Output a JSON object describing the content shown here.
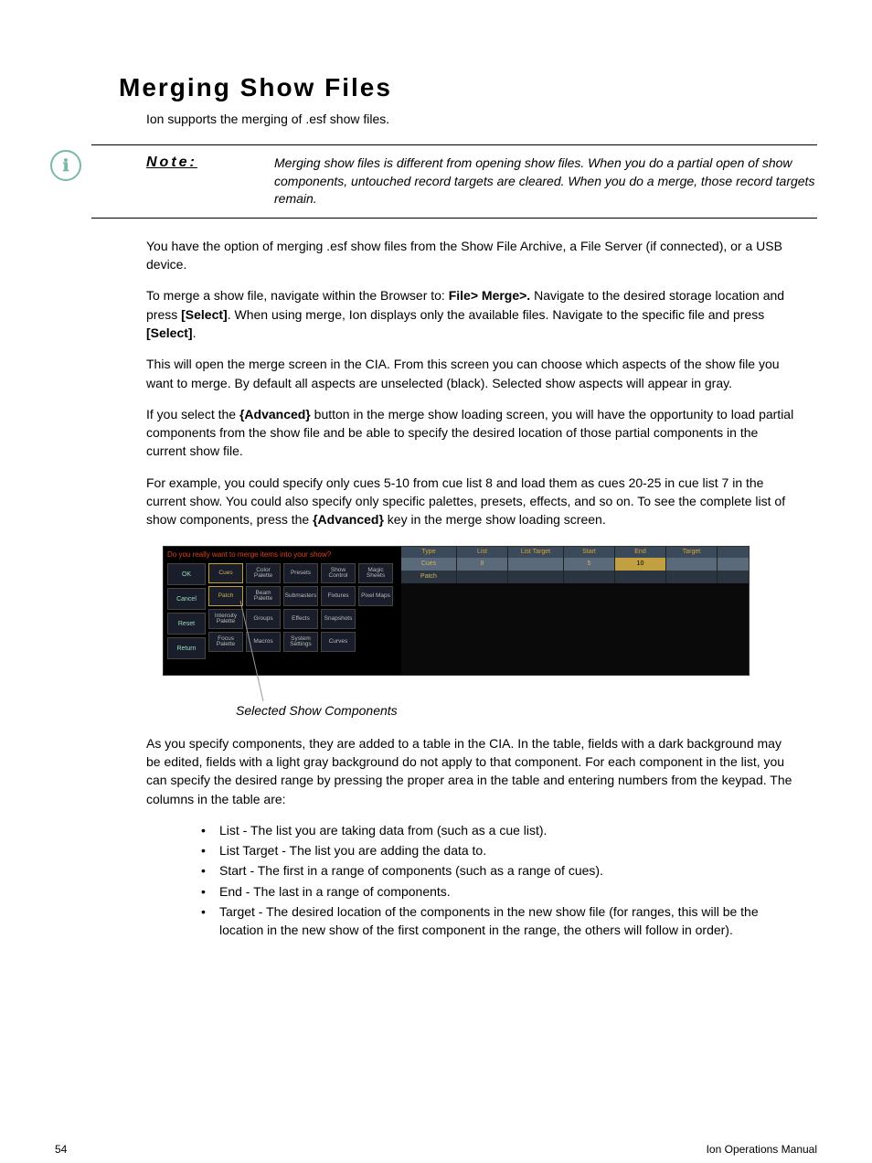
{
  "title": "Merging Show Files",
  "intro": "Ion supports the merging of .esf show files.",
  "note": {
    "label": "Note:",
    "text": "Merging show files is different from opening show files. When you do a partial open of show components, untouched record targets are cleared. When you do a merge, those record targets remain."
  },
  "para1": "You have the option of merging .esf show files from the Show File Archive, a File Server (if connected), or a USB device.",
  "para2_a": "To merge a show file, navigate within the Browser to: ",
  "para2_b": "File> Merge>.",
  "para2_c": " Navigate to the desired storage location and press ",
  "para2_d": "[Select]",
  "para2_e": ". When using merge, Ion displays only the available files. Navigate to the specific file and press ",
  "para2_f": "[Select]",
  "para2_g": ".",
  "para3": "This will open the merge screen in the CIA. From this screen you can choose which aspects of the show file you want to merge. By default all aspects are unselected (black). Selected show aspects will appear in gray.",
  "para4_a": "If you select the ",
  "para4_b": "{Advanced}",
  "para4_c": " button in the merge show loading screen, you will have the opportunity to load partial components from the show file and be able to specify the desired location of those partial components in the current show file.",
  "para5_a": "For example, you could specify only cues 5-10 from cue list 8 and load them as cues 20-25 in cue list 7 in the current show. You could also specify only specific palettes, presets, effects, and so on. To see the complete list of show components, press the ",
  "para5_b": "{Advanced}",
  "para5_c": " key in the merge show loading screen.",
  "screenshot": {
    "prompt": "Do you really want to merge items into your show?",
    "side_buttons": [
      "OK",
      "Cancel",
      "Reset",
      "Return"
    ],
    "grid": [
      [
        "Cues",
        "Color Palette",
        "Presets",
        "Show Control",
        "Magic Sheets"
      ],
      [
        "Patch",
        "Beam Palette",
        "Submasters",
        "Fixtures",
        "Pixel Maps"
      ],
      [
        "Intensity Palette",
        "Groups",
        "Effects",
        "Snapshots",
        ""
      ],
      [
        "Focus Palette",
        "Macros",
        "System Settings",
        "Curves",
        ""
      ]
    ],
    "selected": [
      "Cues",
      "Patch"
    ],
    "table": {
      "headers": [
        "Type",
        "List",
        "List Target",
        "Start",
        "End",
        "Target"
      ],
      "rows": [
        {
          "type": "Cues",
          "list": "8",
          "list_target": "",
          "start": "5",
          "end": "10",
          "target": ""
        },
        {
          "type": "Patch",
          "list": "",
          "list_target": "",
          "start": "",
          "end": "",
          "target": ""
        }
      ]
    }
  },
  "caption": "Selected Show Components",
  "para6": "As you specify components, they are added to a table in the CIA. In the table, fields with a dark background may be edited, fields with a light gray background do not apply to that component. For each component in the list, you can specify the desired range by pressing the proper area in the table and entering numbers from the keypad. The columns in the table are:",
  "columns": [
    "List - The list you are taking data from (such as a cue list).",
    "List Target - The list you are adding the data to.",
    "Start - The first in a range of components (such as a range of cues).",
    "End - The last in a range of components.",
    "Target - The desired location of the components in the new show file (for ranges, this will be the location in the new show of the first component in the range, the others will follow in order)."
  ],
  "footer": {
    "page": "54",
    "doc": "Ion Operations Manual"
  }
}
